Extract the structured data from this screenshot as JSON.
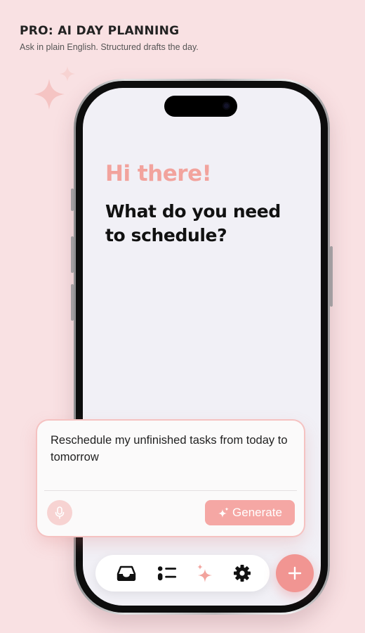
{
  "header": {
    "title": "PRO: AI DAY PLANNING",
    "subtitle": "Ask in plain English. Structured drafts the day."
  },
  "screen": {
    "greeting": "Hi there!",
    "question": "What do you need to schedule?"
  },
  "prompt": {
    "text": "Reschedule my unfinished tasks from today to tomorrow",
    "mic_icon": "mic-icon",
    "generate_label": "Generate",
    "generate_icon": "sparkle-icon"
  },
  "tab_bar": {
    "items": [
      {
        "icon": "inbox-icon"
      },
      {
        "icon": "list-icon"
      },
      {
        "icon": "sparkle-icon",
        "active": true
      },
      {
        "icon": "gear-icon"
      }
    ],
    "add_icon": "plus-icon"
  },
  "colors": {
    "background": "#f9e1e3",
    "accent": "#f2a39d",
    "fab": "#f19592",
    "screen": "#f1f0f6"
  }
}
